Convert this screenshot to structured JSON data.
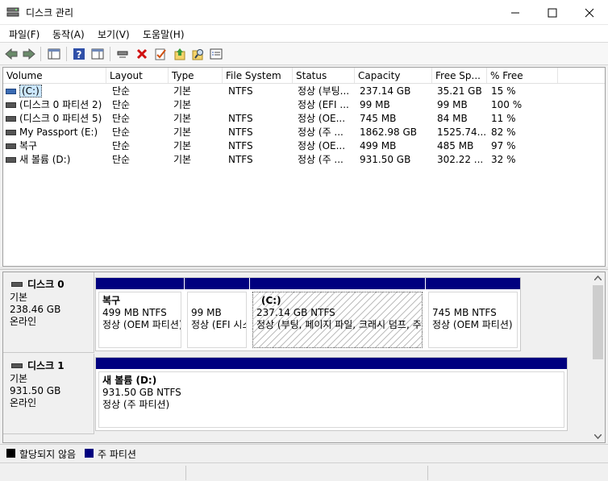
{
  "window": {
    "title": "디스크 관리"
  },
  "menu": [
    "파일(F)",
    "동작(A)",
    "보기(V)",
    "도움말(H)"
  ],
  "toolbar": {
    "icons": [
      "back-icon",
      "forward-icon",
      "console-tree-icon",
      "help-icon",
      "action-pane-icon",
      "connect-icon",
      "delete-icon",
      "properties-icon",
      "up-icon",
      "search-icon",
      "list-icon"
    ]
  },
  "list": {
    "columns": [
      "Volume",
      "Layout",
      "Type",
      "File System",
      "Status",
      "Capacity",
      "Free Sp...",
      "% Free"
    ],
    "rows": [
      {
        "volume": "(C:)",
        "layout": "단순",
        "type": "기본",
        "fs": "NTFS",
        "status": "정상 (부팅...",
        "capacity": "237.14 GB",
        "free": "35.21 GB",
        "pct": "15 %"
      },
      {
        "volume": "(디스크 0 파티션 2)",
        "layout": "단순",
        "type": "기본",
        "fs": "",
        "status": "정상 (EFI ...",
        "capacity": "99 MB",
        "free": "99 MB",
        "pct": "100 %"
      },
      {
        "volume": "(디스크 0 파티션 5)",
        "layout": "단순",
        "type": "기본",
        "fs": "NTFS",
        "status": "정상 (OE...",
        "capacity": "745 MB",
        "free": "84 MB",
        "pct": "11 %"
      },
      {
        "volume": "My Passport (E:)",
        "layout": "단순",
        "type": "기본",
        "fs": "NTFS",
        "status": "정상 (주 ...",
        "capacity": "1862.98 GB",
        "free": "1525.74...",
        "pct": "82 %"
      },
      {
        "volume": "복구",
        "layout": "단순",
        "type": "기본",
        "fs": "NTFS",
        "status": "정상 (OE...",
        "capacity": "499 MB",
        "free": "485 MB",
        "pct": "97 %"
      },
      {
        "volume": "새 볼륨 (D:)",
        "layout": "단순",
        "type": "기본",
        "fs": "NTFS",
        "status": "정상 (주 ...",
        "capacity": "931.50 GB",
        "free": "302.22 ...",
        "pct": "32 %"
      }
    ]
  },
  "disks": [
    {
      "name": "디스크 0",
      "type": "기본",
      "size": "238.46 GB",
      "state": "온라인",
      "partitions": [
        {
          "title": "복구",
          "size": "499 MB NTFS",
          "status": "정상 (OEM 파티션)"
        },
        {
          "title": "",
          "size": "99 MB",
          "status": "정상 (EFI 시스템 파티션)"
        },
        {
          "title": "(C:)",
          "size": "237.14 GB NTFS",
          "status": "정상 (부팅, 페이지 파일, 크래시 덤프, 주 파티션)"
        },
        {
          "title": "",
          "size": "745 MB NTFS",
          "status": "정상 (OEM 파티션)"
        }
      ]
    },
    {
      "name": "디스크 1",
      "type": "기본",
      "size": "931.50 GB",
      "state": "온라인",
      "partitions": [
        {
          "title": "새 볼륨  (D:)",
          "size": "931.50 GB NTFS",
          "status": "정상 (주 파티션)"
        }
      ]
    }
  ],
  "legend": [
    {
      "label": "할당되지 않음",
      "color": "#000000"
    },
    {
      "label": "주 파티션",
      "color": "#00007f"
    }
  ]
}
